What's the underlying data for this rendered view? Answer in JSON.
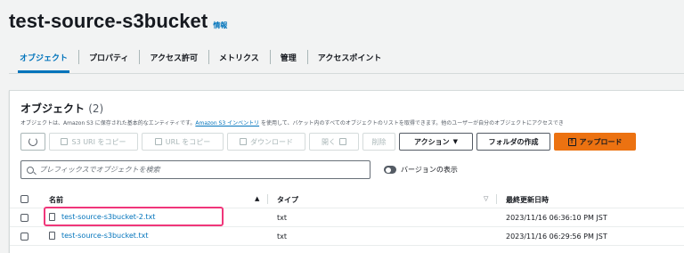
{
  "header": {
    "title": "test-source-s3bucket",
    "info": "情報"
  },
  "tabs": [
    {
      "label": "オブジェクト",
      "active": true
    },
    {
      "label": "プロパティ"
    },
    {
      "label": "アクセス許可"
    },
    {
      "label": "メトリクス"
    },
    {
      "label": "管理"
    },
    {
      "label": "アクセスポイント"
    }
  ],
  "panel": {
    "title": "オブジェクト",
    "count": "(2)",
    "description_pre": "オブジェクトは、Amazon S3 に保存された基本的なエンティティです。",
    "description_link": "Amazon S3 インベントリ",
    "description_post": " を使用して、バケット内のすべてのオブジェクトのリストを取得できます。他のユーザーが自分のオブジェクトにアクセスでき"
  },
  "toolbar": {
    "copy_s3_uri": "S3 URI をコピー",
    "copy_url": "URL をコピー",
    "download": "ダウンロード",
    "open": "開く",
    "delete": "削除",
    "actions": "アクション",
    "create_folder": "フォルダの作成",
    "upload": "アップロード"
  },
  "search": {
    "placeholder": "プレフィックスでオブジェクトを検索"
  },
  "versions_toggle": {
    "label": "バージョンの表示"
  },
  "table": {
    "columns": {
      "name": "名前",
      "type": "タイプ",
      "modified": "最終更新日時"
    },
    "rows": [
      {
        "name": "test-source-s3bucket-2.txt",
        "type": "txt",
        "modified": "2023/11/16 06:36:10 PM JST"
      },
      {
        "name": "test-source-s3bucket.txt",
        "type": "txt",
        "modified": "2023/11/16 06:29:56 PM JST"
      }
    ]
  },
  "colors": {
    "accent": "#0073bb",
    "primary": "#ec7211",
    "highlight": "#f0367a"
  }
}
